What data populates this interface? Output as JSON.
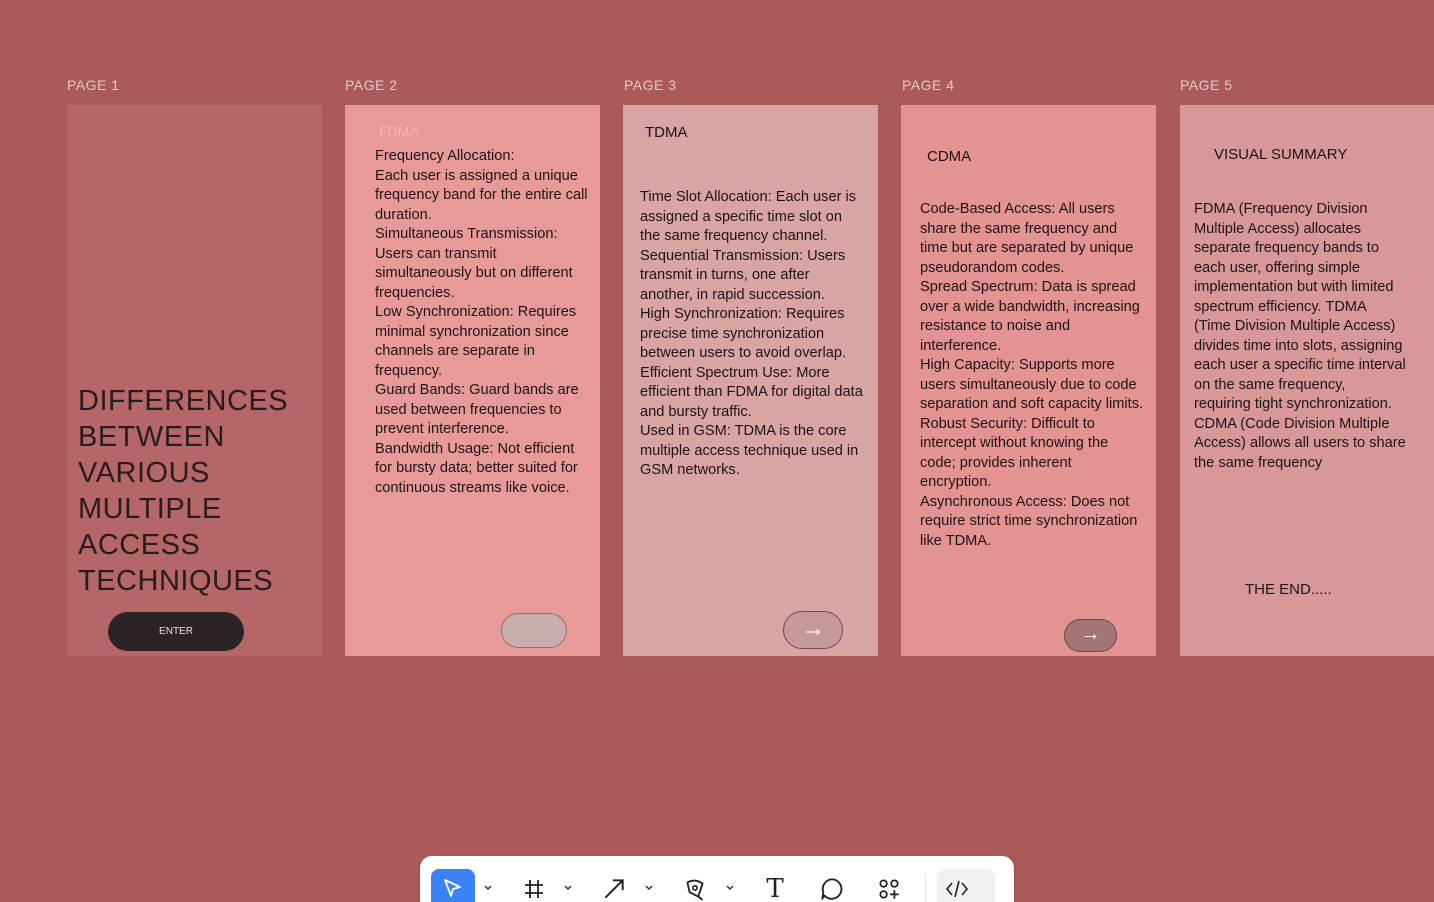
{
  "frames": [
    {
      "label": "PAGE 1"
    },
    {
      "label": "PAGE 2"
    },
    {
      "label": "PAGE 3"
    },
    {
      "label": "PAGE 4"
    },
    {
      "label": "PAGE 5"
    }
  ],
  "page1": {
    "title": "DIFFERENCES\nBETWEEN\nVARIOUS\nMULTIPLE\nACCESS\nTECHNIQUES",
    "enter_label": "ENTER"
  },
  "page2": {
    "faded_heading": "FDMA",
    "body": "Frequency Allocation:\nEach user is assigned a unique frequency band for the entire call duration.\nSimultaneous Transmission: Users can transmit simultaneously but on different frequencies.\nLow Synchronization: Requires minimal synchronization since channels are separate in frequency.\nGuard Bands: Guard bands are used between frequencies to prevent interference.\nBandwidth Usage: Not efficient for bursty data; better suited for continuous streams like voice."
  },
  "page3": {
    "heading": "TDMA",
    "body": "Time Slot Allocation: Each user is assigned a specific time slot on the same frequency channel.\nSequential Transmission: Users transmit in turns, one after another, in rapid succession.\nHigh Synchronization: Requires precise time synchronization between users to avoid overlap.\nEfficient Spectrum Use: More efficient than FDMA for digital data and bursty traffic.\nUsed in GSM: TDMA is the core multiple access technique used in GSM networks.",
    "next_icon": "→"
  },
  "page4": {
    "heading": "CDMA",
    "body": "Code-Based Access: All users share the same frequency and time but are separated by unique pseudorandom codes.\nSpread Spectrum: Data is spread over a wide bandwidth, increasing resistance to noise and interference.\nHigh Capacity: Supports more users simultaneously due to code separation and soft capacity limits.\nRobust Security: Difficult to intercept without knowing the code; provides inherent encryption.\nAsynchronous Access: Does not require strict time synchronization like TDMA.",
    "next_icon": "→"
  },
  "page5": {
    "heading": "VISUAL SUMMARY",
    "body": "FDMA (Frequency Division Multiple Access) allocates separate frequency bands to each user, offering simple implementation but with limited spectrum efficiency. TDMA (Time Division Multiple Access) divides time into slots, assigning each user a specific time interval on the same frequency, requiring tight synchronization. CDMA (Code Division Multiple Access) allows all users to share the same frequency",
    "end_text": "THE END....."
  },
  "toolbar": {
    "tools": [
      "move-tool",
      "frame-tool",
      "arrow-tool",
      "pen-tool",
      "text-tool",
      "shape-tool",
      "components-tool",
      "dev-mode-tool"
    ],
    "text_tool_glyph": "T",
    "active_color": "#3b82f6"
  }
}
